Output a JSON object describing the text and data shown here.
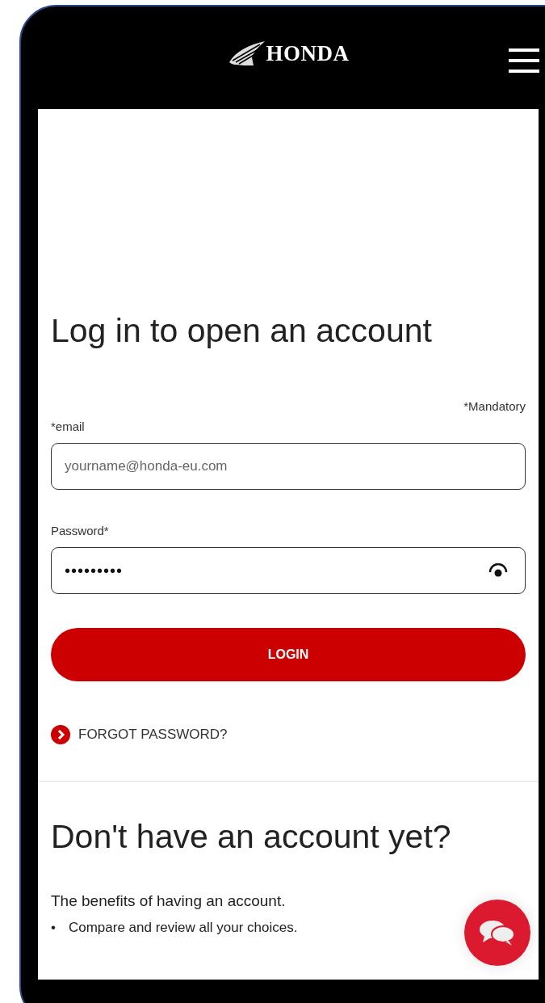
{
  "header": {
    "logo": "HONDA"
  },
  "login": {
    "title": "Log in to open an account",
    "mandatory_note": "*Mandatory",
    "fields": [
      {
        "kind": "text",
        "label": "*email",
        "placeholder": "yourname@honda-eu.com"
      },
      {
        "kind": "password",
        "label": "Password*",
        "value": "•••••••••"
      }
    ],
    "submit": "LOGIN",
    "forgot_link": "FORGOT PASSWORD?"
  },
  "signup": {
    "title": "Don't have an account yet?",
    "intro": "The benefits of having an account.",
    "benefits": [
      {
        "bullet": "•",
        "text": "Compare and review all your choices."
      }
    ]
  }
}
